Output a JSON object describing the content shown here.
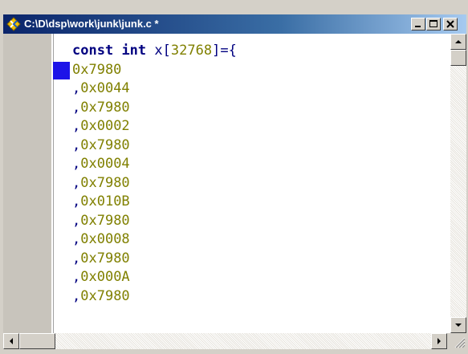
{
  "window": {
    "title": "C:\\D\\dsp\\work\\junk\\junk.c *",
    "icon": "source-file-icon"
  },
  "editor": {
    "declaration": {
      "keyword1": "const",
      "keyword2": "int",
      "identifier": "x",
      "open_bracket": "[",
      "size": "32768",
      "close": "]={"
    },
    "lines": [
      {
        "prefix": "",
        "value": "0x7980"
      },
      {
        "prefix": ",",
        "value": "0x0044"
      },
      {
        "prefix": ",",
        "value": "0x7980"
      },
      {
        "prefix": ",",
        "value": "0x0002"
      },
      {
        "prefix": ",",
        "value": "0x7980"
      },
      {
        "prefix": ",",
        "value": "0x0004"
      },
      {
        "prefix": ",",
        "value": "0x7980"
      },
      {
        "prefix": ",",
        "value": "0x010B"
      },
      {
        "prefix": ",",
        "value": "0x7980"
      },
      {
        "prefix": ",",
        "value": "0x0008"
      },
      {
        "prefix": ",",
        "value": "0x7980"
      },
      {
        "prefix": ",",
        "value": "0x000A"
      },
      {
        "prefix": ",",
        "value": "0x7980"
      }
    ],
    "colors": {
      "keyword": "#000080",
      "number": "#808000",
      "bookmark": "#1d14e8",
      "gutter": "#c8c4bc"
    }
  },
  "icons": {
    "minimize": "minimize-icon",
    "maximize": "maximize-icon",
    "close": "close-icon",
    "scroll_up": "arrow-up-icon",
    "scroll_down": "arrow-down-icon",
    "scroll_left": "arrow-left-icon",
    "scroll_right": "arrow-right-icon"
  }
}
